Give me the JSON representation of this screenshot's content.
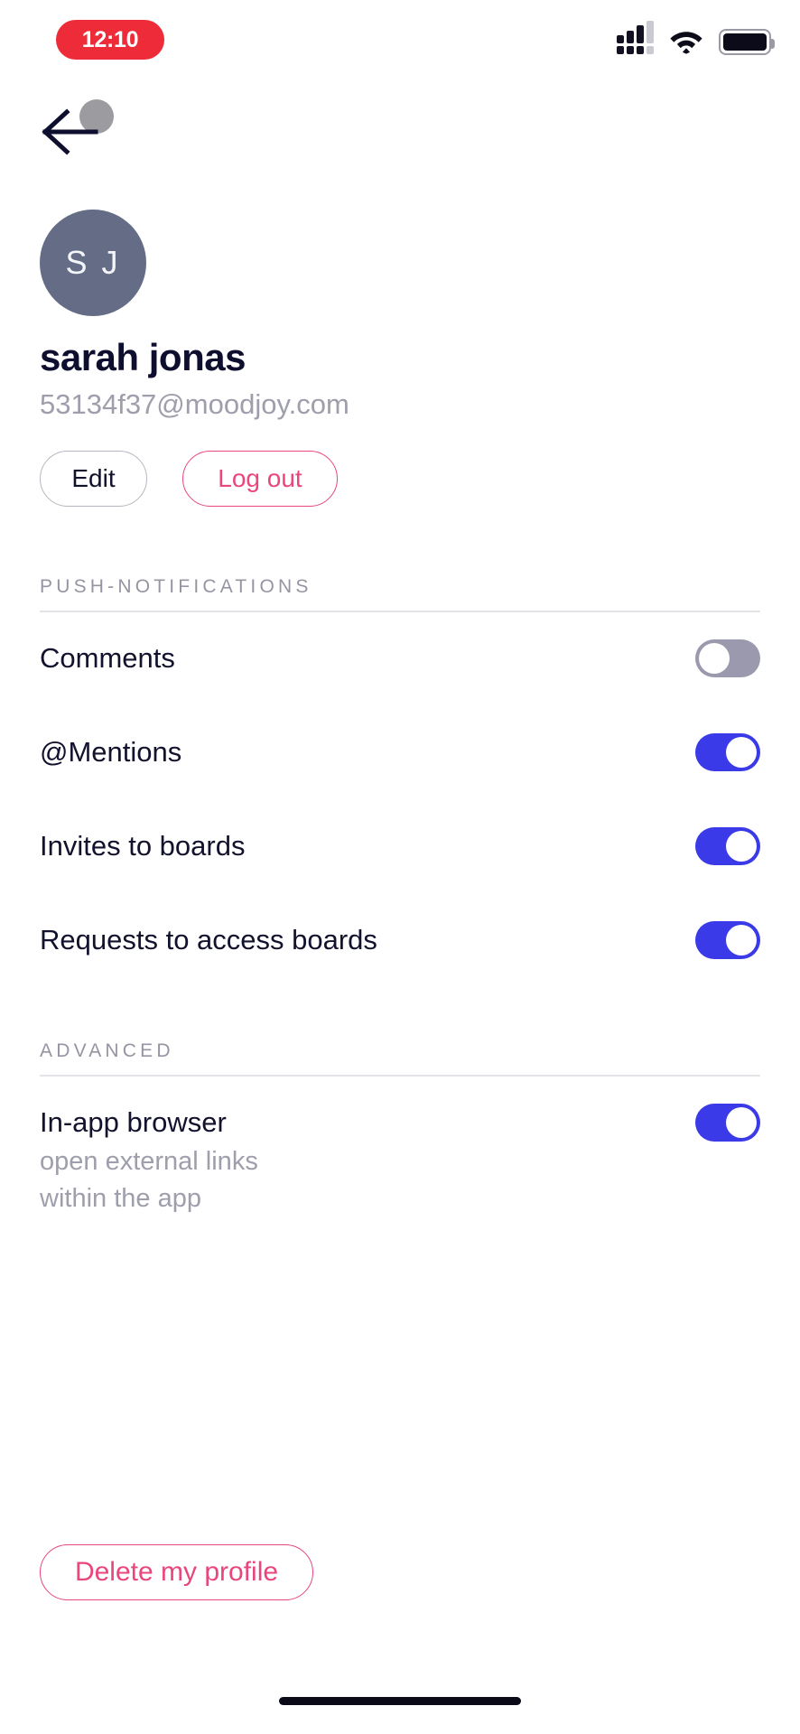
{
  "statusbar": {
    "time": "12:10",
    "signal_icon": "cellular-signal-icon",
    "wifi_icon": "wifi-icon",
    "battery_icon": "battery-full-icon",
    "signal_bars_filled": 3,
    "signal_bars_total": 4
  },
  "nav": {
    "back_icon": "back-arrow-icon"
  },
  "profile": {
    "initials": "S J",
    "name": "sarah jonas",
    "email": "53134f37@moodjoy.com",
    "avatar_color": "#646C86",
    "edit_label": "Edit",
    "logout_label": "Log out"
  },
  "sections": [
    {
      "title": "PUSH-NOTIFICATIONS",
      "rows": [
        {
          "label": "Comments",
          "state": "off"
        },
        {
          "label": "@Mentions",
          "state": "on"
        },
        {
          "label": "Invites to boards",
          "state": "on"
        },
        {
          "label": "Requests to access boards",
          "state": "on"
        }
      ]
    },
    {
      "title": "ADVANCED",
      "rows": [
        {
          "label": "In-app browser",
          "sub_line1": "open external links",
          "sub_line2": "within the app",
          "state": "on"
        }
      ]
    }
  ],
  "delete": {
    "label": "Delete my profile"
  },
  "colors": {
    "accent_blue": "#3A3AE8",
    "toggle_off": "#9A99AD",
    "danger_pink": "#E8467C",
    "clock_red": "#EE2B38",
    "text_dark": "#12122E",
    "text_muted": "#9E9EAC"
  }
}
